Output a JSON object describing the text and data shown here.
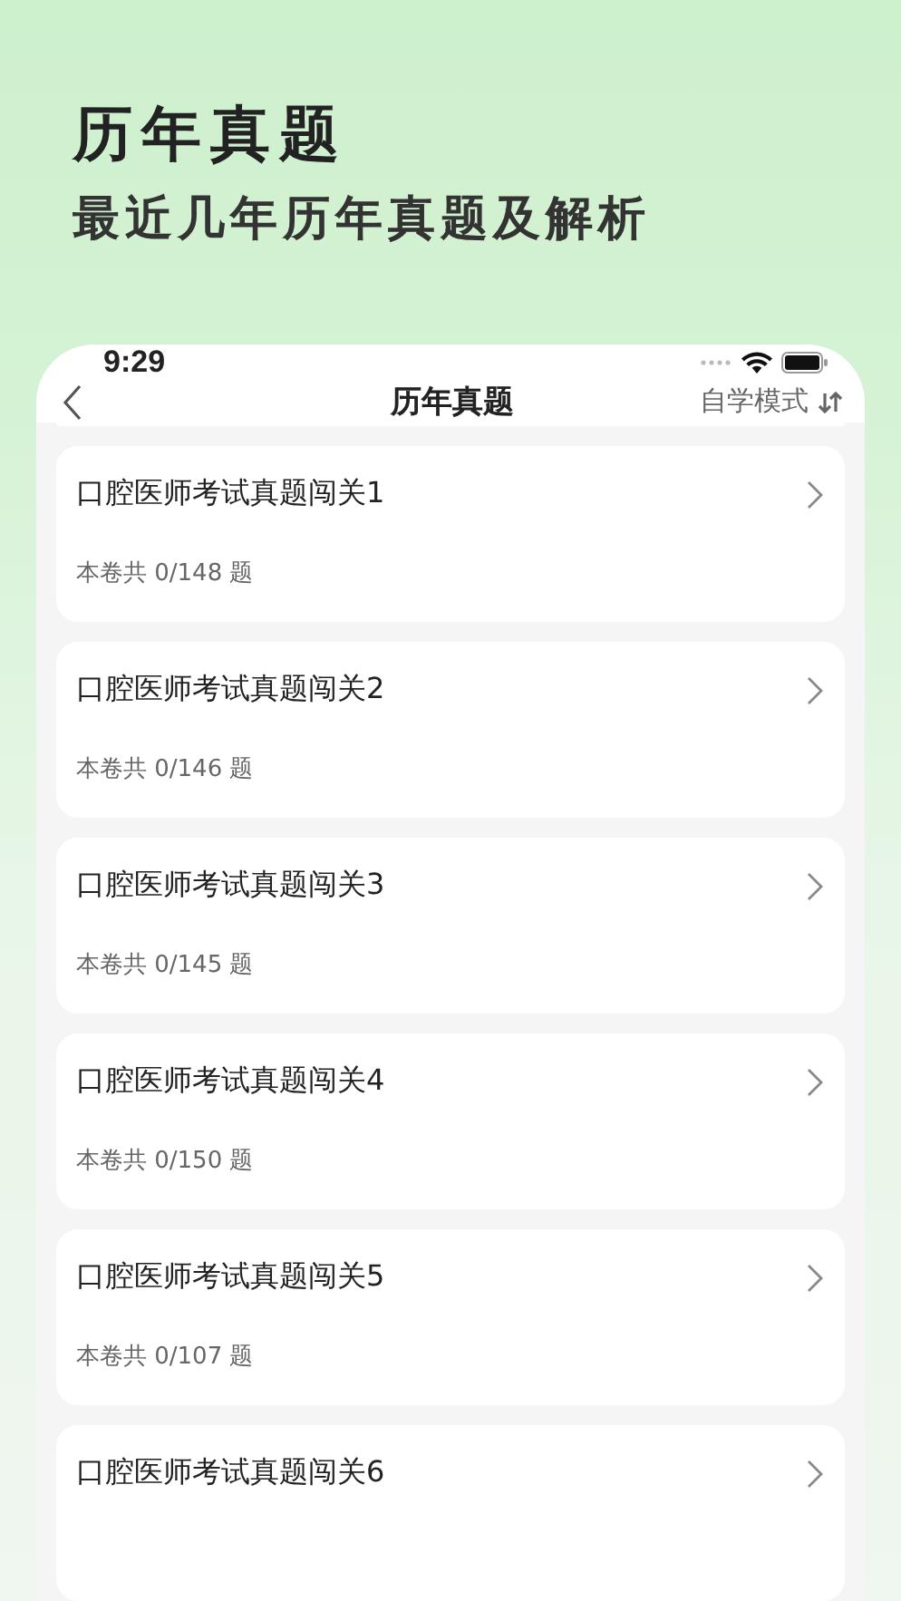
{
  "promo": {
    "title": "历年真题",
    "subtitle": "最近几年历年真题及解析"
  },
  "status_bar": {
    "time": "9:29"
  },
  "nav": {
    "title": "历年真题",
    "mode": "自学模式"
  },
  "papers": [
    {
      "title": "口腔医师考试真题闯关1",
      "count": "本卷共 0/148 题"
    },
    {
      "title": "口腔医师考试真题闯关2",
      "count": "本卷共 0/146 题"
    },
    {
      "title": "口腔医师考试真题闯关3",
      "count": "本卷共 0/145 题"
    },
    {
      "title": "口腔医师考试真题闯关4",
      "count": "本卷共 0/150 题"
    },
    {
      "title": "口腔医师考试真题闯关5",
      "count": "本卷共 0/107 题"
    },
    {
      "title": "口腔医师考试真题闯关6"
    }
  ]
}
